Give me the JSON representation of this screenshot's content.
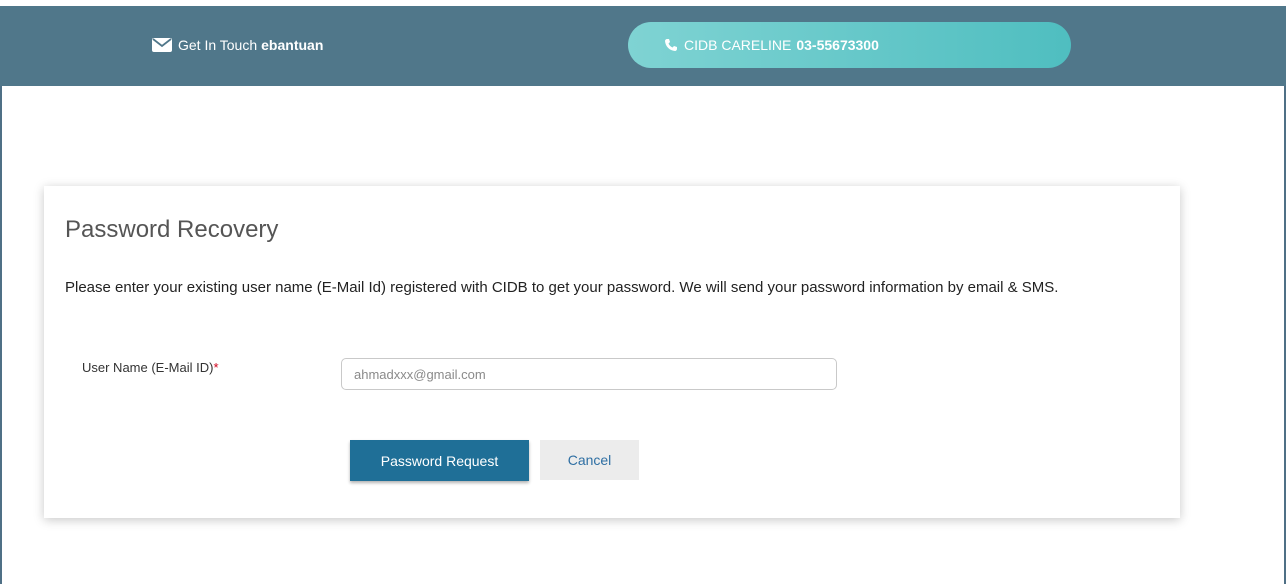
{
  "header": {
    "contact_label": "Get In Touch",
    "contact_name": "ebantuan",
    "careline_label": "CIDB CARELINE",
    "careline_number": "03-55673300",
    "bar_color": "#50778a",
    "careline_color": "#58c2c3"
  },
  "card": {
    "title": "Password Recovery",
    "description": "Please enter your existing user name (E-Mail Id) registered with CIDB to get your password. We will send your password information by email & SMS.",
    "username_label": "User Name (E-Mail ID)",
    "required_marker": "*",
    "username_placeholder": "ahmadxxx@gmail.com",
    "submit_label": "Password Request",
    "cancel_label": "Cancel"
  },
  "icons": {
    "contact": "envelope-icon",
    "careline": "phone-icon"
  }
}
